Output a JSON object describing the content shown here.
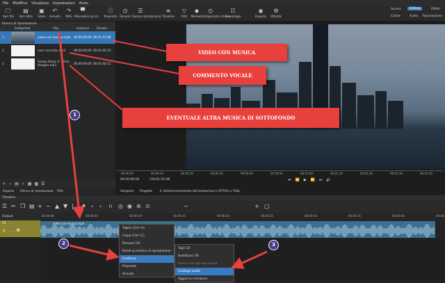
{
  "menu": [
    "File",
    "Modifica",
    "Visualizza",
    "Impostazioni",
    "Aiuto"
  ],
  "toolbar": [
    {
      "label": "Apri file",
      "icon": "folder-open-icon",
      "glyph": "🗁"
    },
    {
      "label": "Apri altro",
      "icon": "open-other-icon",
      "glyph": "▤"
    },
    {
      "label": "Salva",
      "icon": "save-icon",
      "glyph": "▣"
    },
    {
      "label": "Annulla",
      "icon": "undo-icon",
      "glyph": "↶"
    },
    {
      "label": "Rifai",
      "icon": "redo-icon",
      "glyph": "↷"
    },
    {
      "label": "Misuratore picco",
      "icon": "peak-meter-icon",
      "glyph": "▀"
    },
    {
      "label": "Proprietà",
      "icon": "properties-icon",
      "glyph": "ⓘ"
    },
    {
      "label": "Recenti",
      "icon": "recent-icon",
      "glyph": "◷"
    },
    {
      "label": "Elenco riproduzione",
      "icon": "playlist-icon",
      "glyph": "☰"
    },
    {
      "label": "Timeline",
      "icon": "timeline-icon",
      "glyph": "≡"
    },
    {
      "label": "Filtri",
      "icon": "filter-icon",
      "glyph": "▽"
    },
    {
      "label": "Markers",
      "icon": "marker-icon",
      "glyph": "◆"
    },
    {
      "label": "Fotogrammi chiave",
      "icon": "keyframe-icon",
      "glyph": "◴"
    },
    {
      "label": "Cronologia",
      "icon": "history-icon",
      "glyph": "☷"
    },
    {
      "label": "Esporta",
      "icon": "export-icon",
      "glyph": "◉"
    },
    {
      "label": "Attività",
      "icon": "jobs-icon",
      "glyph": "⚙"
    }
  ],
  "layouts": {
    "row1": [
      "Access",
      "Editing",
      "Effetti"
    ],
    "row2": [
      "Colore",
      "Audio",
      "Riproduzione"
    ],
    "active": "Editing"
  },
  "playlist": {
    "title": "Elenco di riproduzione",
    "columns": [
      "Anteprima",
      "Clip",
      "Ingresso",
      "Durata"
    ],
    "rows": [
      {
        "num": "1",
        "clip": "video con musica.mp4",
        "in": "00:00:00:00",
        "dur": "00:01:51:08"
      },
      {
        "num": "2",
        "clip": "voce narrante.mp3",
        "in": "00:00:00:00",
        "dur": "00:01:45:15"
      },
      {
        "num": "3",
        "clip": "Snowy Peaks II - Chris Haugen.mp3",
        "in": "00:00:00:00",
        "dur": "00:02:40:11"
      }
    ],
    "tabs": [
      "Esporta",
      "Elenco di riproduzione",
      "Filtri"
    ]
  },
  "viewer": {
    "timecode": "00:00:00:00",
    "total": "/ 00:01:51:08",
    "ticks": [
      "00:00:00",
      "00:00:10",
      "00:00:20",
      "00:00:30",
      "00:00:40",
      "00:00:50",
      "00:01:00",
      "00:01:10",
      "00:01:20",
      "00:01:30",
      "00:01:40"
    ],
    "tabs": [
      "Sorgente",
      "Progetto"
    ],
    "status": "Il ridimensionamento dell'anteprima è ATTIVO a 720p"
  },
  "callouts": {
    "a": "VIDEO CON MUSICA",
    "b": "COMMENTO VOCALE",
    "c": "EVENTUALE ALTRA MUSICA DI SOTTOFONDO"
  },
  "timeline": {
    "title": "Timeline",
    "output": "Output",
    "track": "V1",
    "clip_label": "video con musica.mp4",
    "ruler": [
      "00:00:00",
      "00:00:05",
      "00:00:10",
      "00:00:15",
      "00:00:20",
      "00:00:25",
      "00:00:30",
      "00:00:35",
      "00:00:40",
      "00:00:45"
    ]
  },
  "context_menu": [
    "Taglia (Ctrl+X)",
    "Copia (Ctrl+C)",
    "Rimuovi (X)",
    "Dividi su testina di riproduzione (S)",
    "Continua",
    "Proprietà",
    "Annulla"
  ],
  "submenu": [
    "Togli (Z)",
    "Sostituisci (R)",
    "Unisci con clip successiva",
    "Scollega audio",
    "Aggiorna miniature"
  ],
  "badges": [
    "1",
    "2",
    "3"
  ]
}
